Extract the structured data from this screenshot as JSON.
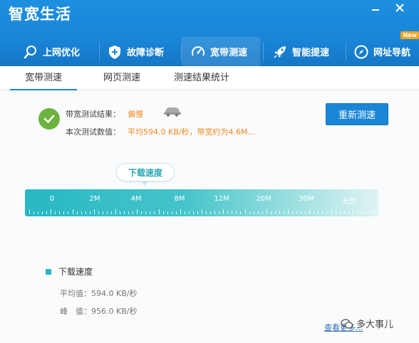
{
  "app": {
    "title": "智宽生活"
  },
  "nav": {
    "items": [
      {
        "label": "上网优化",
        "icon": "search-icon"
      },
      {
        "label": "故障诊断",
        "icon": "shield-icon"
      },
      {
        "label": "宽带测速",
        "icon": "speedometer-icon",
        "active": true
      },
      {
        "label": "智能提速",
        "icon": "rocket-icon"
      },
      {
        "label": "网址导航",
        "icon": "compass-icon",
        "badge": "New"
      }
    ]
  },
  "subtabs": [
    {
      "label": "宽带测速",
      "active": true
    },
    {
      "label": "网页测速"
    },
    {
      "label": "测速结果统计"
    }
  ],
  "result": {
    "line1_label": "带宽测试结果：",
    "line1_value": "偏慢",
    "line2_label": "本次测试数值：",
    "line2_value": "平均594.0 KB/秒，带宽约为4.6M..."
  },
  "retest_button": "重新测速",
  "gauge": {
    "bubble_label": "下载速度",
    "ticks": [
      "0",
      "2M",
      "4M",
      "8M",
      "12M",
      "20M",
      "30M",
      "无忧"
    ]
  },
  "stats": {
    "legend": "下载速度",
    "avg": "平均值：594.0 KB/秒",
    "peak": "峰　值：956.0 KB/秒"
  },
  "footer": {
    "more_link": "查看更多...",
    "watermark": "多大事儿"
  },
  "colors": {
    "primary": "#1a86d8",
    "accent": "#28b6c4",
    "warning": "#f18a21",
    "success": "#6db33f"
  }
}
